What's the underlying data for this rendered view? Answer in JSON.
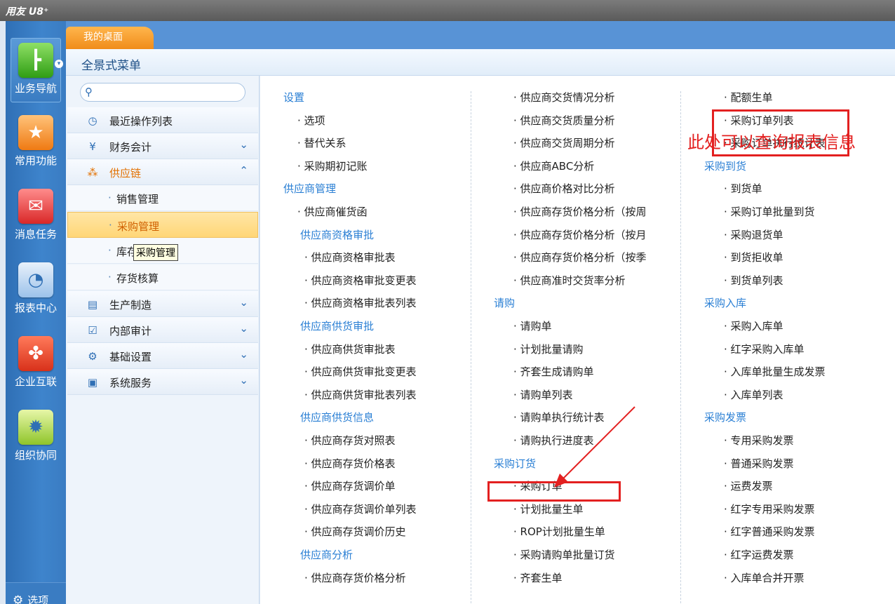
{
  "app": {
    "title": "用友 U8⁺"
  },
  "rail": [
    {
      "label": "业务导航",
      "icon": "business-nav-icon"
    },
    {
      "label": "常用功能",
      "icon": "favorites-icon"
    },
    {
      "label": "消息任务",
      "icon": "message-icon"
    },
    {
      "label": "报表中心",
      "icon": "report-icon"
    },
    {
      "label": "企业互联",
      "icon": "enterprise-connect-icon"
    },
    {
      "label": "组织协同",
      "icon": "org-collab-icon"
    }
  ],
  "rail_options": "选项",
  "tab": {
    "label": "我的桌面"
  },
  "menu": {
    "title": "全景式菜单"
  },
  "search": {
    "placeholder": ""
  },
  "sidebar": {
    "recent": "最近操作列表",
    "finance": "财务会计",
    "supply": "供应链",
    "sub": [
      "销售管理",
      "采购管理",
      "库存管理",
      "存货核算"
    ],
    "sub_visible_3": "库存",
    "production": "生产制造",
    "audit": "内部审计",
    "basic": "基础设置",
    "system": "系统服务"
  },
  "tooltip": "采购管理",
  "columns": {
    "col1": [
      {
        "t": "设置",
        "h": true
      },
      {
        "t": "· 选项"
      },
      {
        "t": "· 替代关系"
      },
      {
        "t": "· 采购期初记账"
      },
      {
        "t": "供应商管理",
        "h": true
      },
      {
        "t": "· 供应商催货函"
      },
      {
        "t": "供应商资格审批",
        "h": true,
        "indent": true
      },
      {
        "t": "· 供应商资格审批表"
      },
      {
        "t": "· 供应商资格审批变更表"
      },
      {
        "t": "· 供应商资格审批表列表"
      },
      {
        "t": "供应商供货审批",
        "h": true,
        "indent": true
      },
      {
        "t": "· 供应商供货审批表"
      },
      {
        "t": "· 供应商供货审批变更表"
      },
      {
        "t": "· 供应商供货审批表列表"
      },
      {
        "t": "供应商供货信息",
        "h": true,
        "indent": true
      },
      {
        "t": "· 供应商存货对照表"
      },
      {
        "t": "· 供应商存货价格表"
      },
      {
        "t": "· 供应商存货调价单"
      },
      {
        "t": "· 供应商存货调价单列表"
      },
      {
        "t": "· 供应商存货调价历史"
      },
      {
        "t": "供应商分析",
        "h": true,
        "indent": true
      },
      {
        "t": "· 供应商存货价格分析"
      }
    ],
    "col2": [
      {
        "t": "· 供应商交货情况分析"
      },
      {
        "t": "· 供应商交货质量分析"
      },
      {
        "t": "· 供应商交货周期分析"
      },
      {
        "t": "· 供应商ABC分析"
      },
      {
        "t": "· 供应商价格对比分析"
      },
      {
        "t": "· 供应商存货价格分析（按周"
      },
      {
        "t": "· 供应商存货价格分析（按月"
      },
      {
        "t": "· 供应商存货价格分析（按季"
      },
      {
        "t": "· 供应商准时交货率分析"
      },
      {
        "t": "请购",
        "h": true
      },
      {
        "t": "· 请购单"
      },
      {
        "t": "· 计划批量请购"
      },
      {
        "t": "· 齐套生成请购单"
      },
      {
        "t": "· 请购单列表"
      },
      {
        "t": "· 请购单执行统计表"
      },
      {
        "t": "· 请购执行进度表"
      },
      {
        "t": "采购订货",
        "h": true
      },
      {
        "t": "· 采购订单"
      },
      {
        "t": "· 计划批量生单"
      },
      {
        "t": "· ROP计划批量生单"
      },
      {
        "t": "· 采购请购单批量订货"
      },
      {
        "t": "· 齐套生单"
      }
    ],
    "col3": [
      {
        "t": "· 配额生单"
      },
      {
        "t": "· 采购订单列表"
      },
      {
        "t": "· 采购订单执行统计表"
      },
      {
        "t": "采购到货",
        "h": true
      },
      {
        "t": "· 到货单"
      },
      {
        "t": "· 采购订单批量到货"
      },
      {
        "t": "· 采购退货单"
      },
      {
        "t": "· 到货拒收单"
      },
      {
        "t": "· 到货单列表"
      },
      {
        "t": "采购入库",
        "h": true
      },
      {
        "t": "· 采购入库单"
      },
      {
        "t": "· 红字采购入库单"
      },
      {
        "t": "· 入库单批量生成发票"
      },
      {
        "t": "· 入库单列表"
      },
      {
        "t": "采购发票",
        "h": true
      },
      {
        "t": "· 专用采购发票"
      },
      {
        "t": "· 普通采购发票"
      },
      {
        "t": "· 运费发票"
      },
      {
        "t": "· 红字专用采购发票"
      },
      {
        "t": "· 红字普通采购发票"
      },
      {
        "t": "· 红字运费发票"
      },
      {
        "t": "· 入库单合并开票"
      }
    ]
  },
  "annotation": {
    "note": "此处可以查询报表信息",
    "color": "#e32020"
  }
}
